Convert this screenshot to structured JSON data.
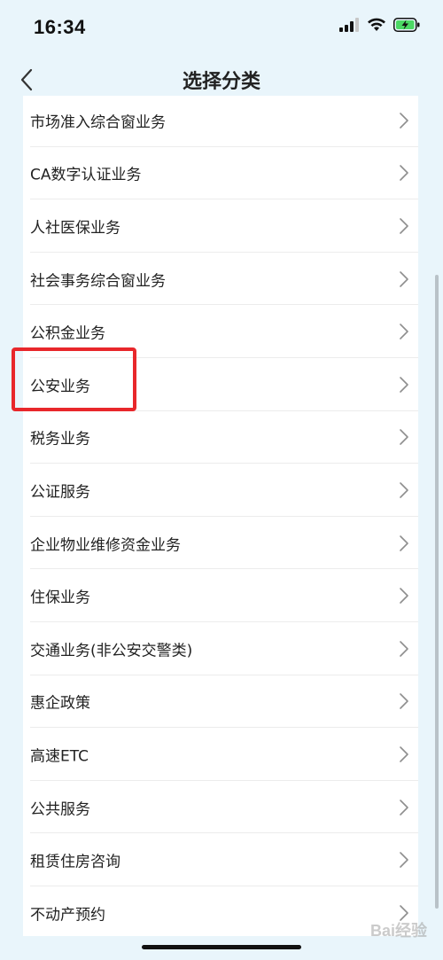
{
  "status_bar": {
    "time": "16:34"
  },
  "nav": {
    "title": "选择分类",
    "back_icon": "chevron-left-icon"
  },
  "list": {
    "items": [
      {
        "label": "市场准入综合窗业务"
      },
      {
        "label": "CA数字认证业务"
      },
      {
        "label": "人社医保业务"
      },
      {
        "label": "社会事务综合窗业务"
      },
      {
        "label": "公积金业务"
      },
      {
        "label": "公安业务"
      },
      {
        "label": "税务业务"
      },
      {
        "label": "公证服务"
      },
      {
        "label": "企业物业维修资金业务"
      },
      {
        "label": "住保业务"
      },
      {
        "label": "交通业务(非公安交警类)"
      },
      {
        "label": "惠企政策"
      },
      {
        "label": "高速ETC"
      },
      {
        "label": "公共服务"
      },
      {
        "label": "租赁住房咨询"
      },
      {
        "label": "不动产预约"
      }
    ]
  },
  "highlighted_item": "公安业务",
  "watermark": "Bai经验",
  "colors": {
    "background": "#e9f5fb",
    "highlight": "#e8272b",
    "battery": "#4cd964"
  }
}
